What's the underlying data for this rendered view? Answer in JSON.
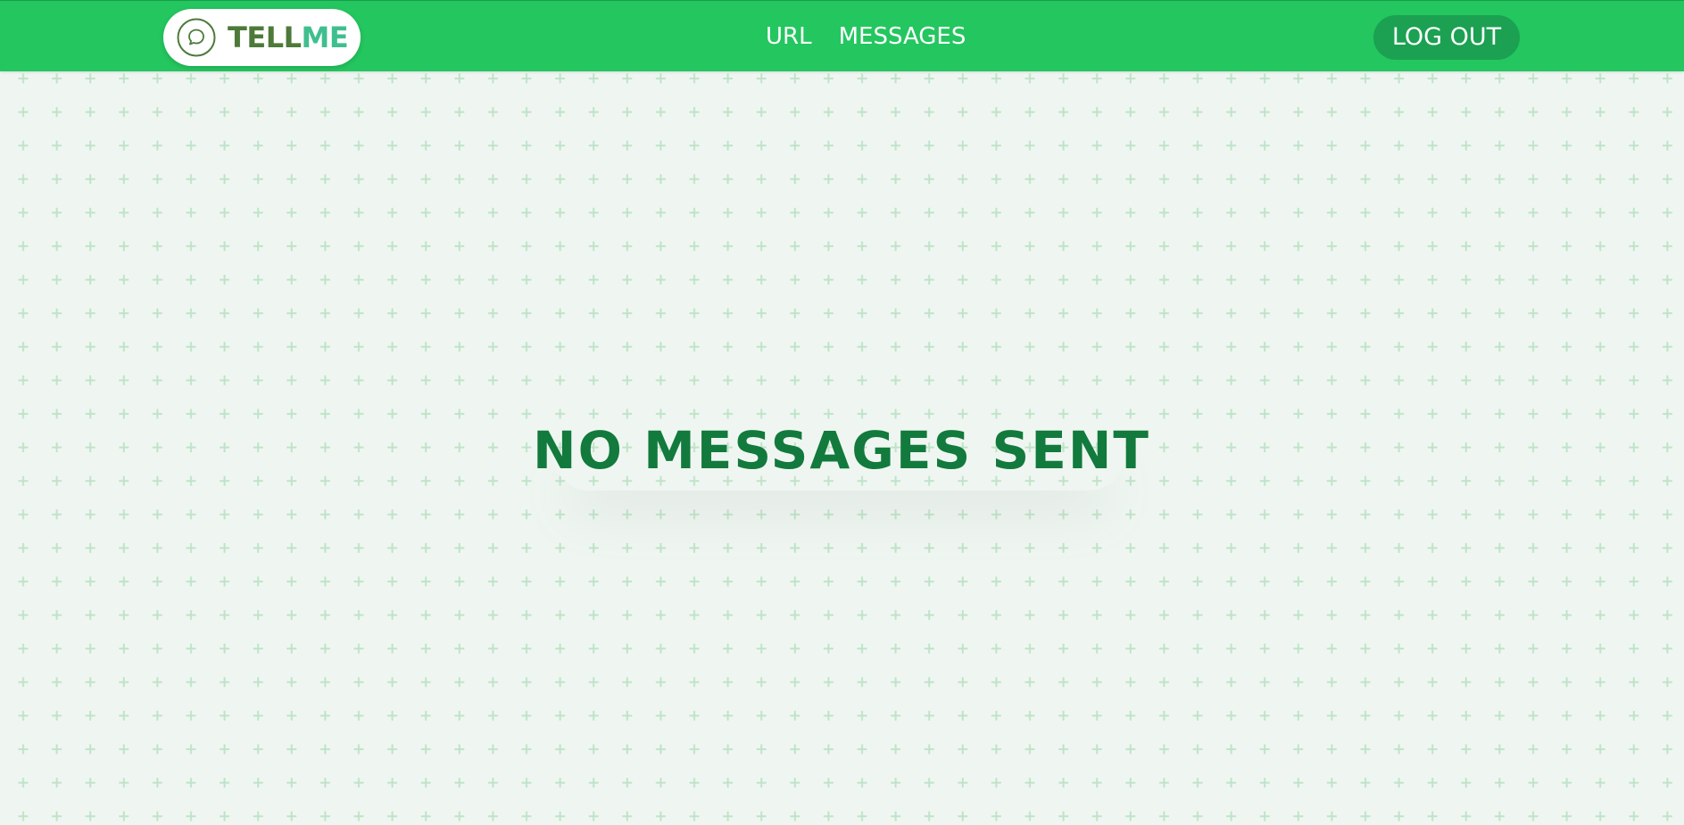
{
  "navbar": {
    "logo": {
      "part1": "TELL",
      "part2": "ME",
      "icon": "speech-bubble-icon"
    },
    "links": [
      {
        "label": "URL"
      },
      {
        "label": "MESSAGES"
      }
    ],
    "logout_label": "LOG OUT"
  },
  "main": {
    "empty_state": "NO MESSAGES SENT"
  },
  "colors": {
    "navbar_bg": "#24c65f",
    "logout_bg": "#1ba151",
    "logo_tell": "#4d7a39",
    "logo_me": "#3fbf8f",
    "empty_text": "#127a3c",
    "page_bg": "#eff6f1",
    "pattern_plus": "#bfe3c8"
  }
}
